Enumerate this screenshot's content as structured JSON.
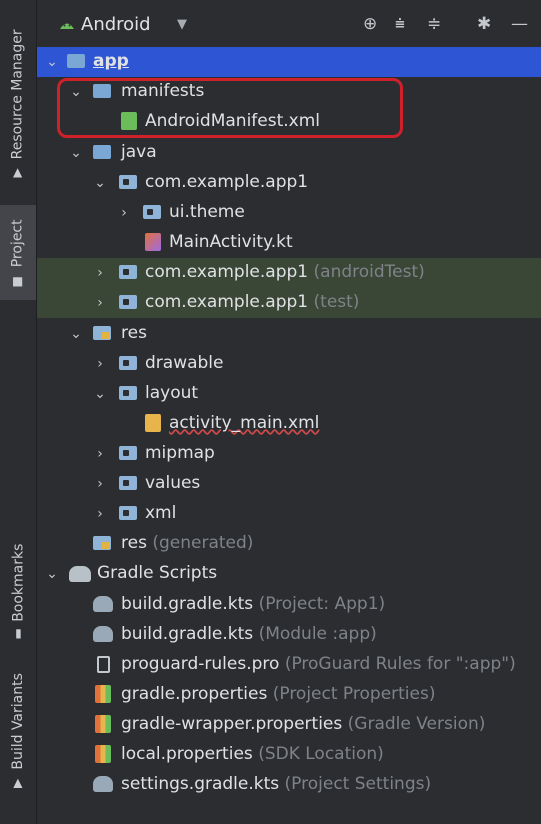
{
  "side_tabs": {
    "resource_manager": "Resource Manager",
    "project": "Project",
    "bookmarks": "Bookmarks",
    "build_variants": "Build Variants"
  },
  "header": {
    "title": "Android"
  },
  "tree": {
    "app": "app",
    "manifests": "manifests",
    "android_manifest": "AndroidManifest.xml",
    "java": "java",
    "pkg_main": "com.example.app1",
    "ui_theme": "ui.theme",
    "main_activity": "MainActivity.kt",
    "pkg_android_test": "com.example.app1",
    "pkg_android_test_hint": "(androidTest)",
    "pkg_test": "com.example.app1",
    "pkg_test_hint": "(test)",
    "res": "res",
    "drawable": "drawable",
    "layout": "layout",
    "activity_main": "activity_main.xml",
    "mipmap": "mipmap",
    "values": "values",
    "xml": "xml",
    "res_generated": "res",
    "res_generated_hint": "(generated)",
    "gradle_scripts": "Gradle Scripts",
    "build_gradle_project": "build.gradle.kts",
    "build_gradle_project_hint": "(Project: App1)",
    "build_gradle_module": "build.gradle.kts",
    "build_gradle_module_hint": "(Module :app)",
    "proguard": "proguard-rules.pro",
    "proguard_hint": "(ProGuard Rules for \":app\")",
    "gradle_properties": "gradle.properties",
    "gradle_properties_hint": "(Project Properties)",
    "gradle_wrapper": "gradle-wrapper.properties",
    "gradle_wrapper_hint": "(Gradle Version)",
    "local_properties": "local.properties",
    "local_properties_hint": "(SDK Location)",
    "settings_gradle": "settings.gradle.kts",
    "settings_gradle_hint": "(Project Settings)"
  },
  "colors": {
    "selection": "#2e55d3",
    "highlight_box": "#d0212b",
    "test_row": "#3a4636"
  }
}
